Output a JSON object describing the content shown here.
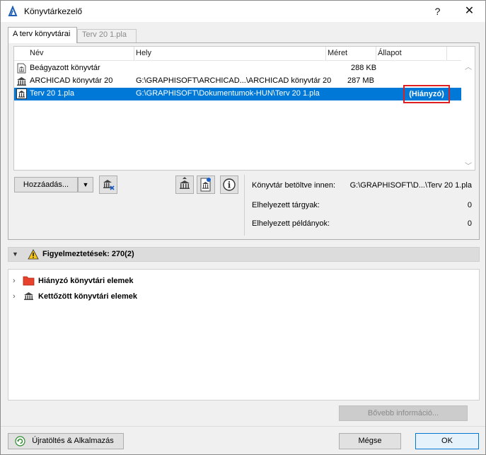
{
  "window": {
    "title": "Könyvtárkezelő",
    "help_label": "?",
    "close_label": "✕"
  },
  "tabs": [
    {
      "label": "A terv könyvtárai",
      "active": true
    },
    {
      "label": "Terv 20 1.pla",
      "active": false
    }
  ],
  "library_list": {
    "columns": {
      "name": "Név",
      "location": "Hely",
      "size": "Méret",
      "status": "Állapot"
    },
    "rows": [
      {
        "name": "Beágyazott könyvtár",
        "location": "",
        "size": "288 KB",
        "status": ""
      },
      {
        "name": "ARCHICAD könyvtár 20",
        "location": "G:\\GRAPHISOFT\\ARCHICAD...\\ARCHICAD könyvtár 20",
        "size": "287 MB",
        "status": ""
      },
      {
        "name": "Terv 20 1.pla",
        "location": "G:\\GRAPHISOFT\\Dokumentumok-HUN\\Terv 20 1.pla",
        "size": "",
        "status": "(Hiányzó)"
      }
    ]
  },
  "controls": {
    "add_label": "Hozzáadás...",
    "add_arrow": "▼",
    "info_label": "i"
  },
  "info": {
    "loaded_from_label": "Könyvtár betöltve innen:",
    "loaded_from_value": "G:\\GRAPHISOFT\\D...\\Terv 20 1.pla",
    "placed_objects_label": "Elhelyezett tárgyak:",
    "placed_objects_value": "0",
    "placed_instances_label": "Elhelyezett példányok:",
    "placed_instances_value": "0"
  },
  "warnings": {
    "header": "Figyelmeztetések: 270(2)",
    "items": [
      {
        "label": "Hiányzó könyvtári elemek",
        "icon": "red-folder-icon"
      },
      {
        "label": "Kettőzött könyvtári elemek",
        "icon": "library-icon"
      }
    ],
    "more_info_label": "Bővebb információ..."
  },
  "footer": {
    "reload_label": "Újratöltés & Alkalmazás",
    "cancel_label": "Mégse",
    "ok_label": "OK"
  },
  "colors": {
    "selection": "#0078d7",
    "highlight_box": "#e02020",
    "folder_red": "#e8412c"
  }
}
